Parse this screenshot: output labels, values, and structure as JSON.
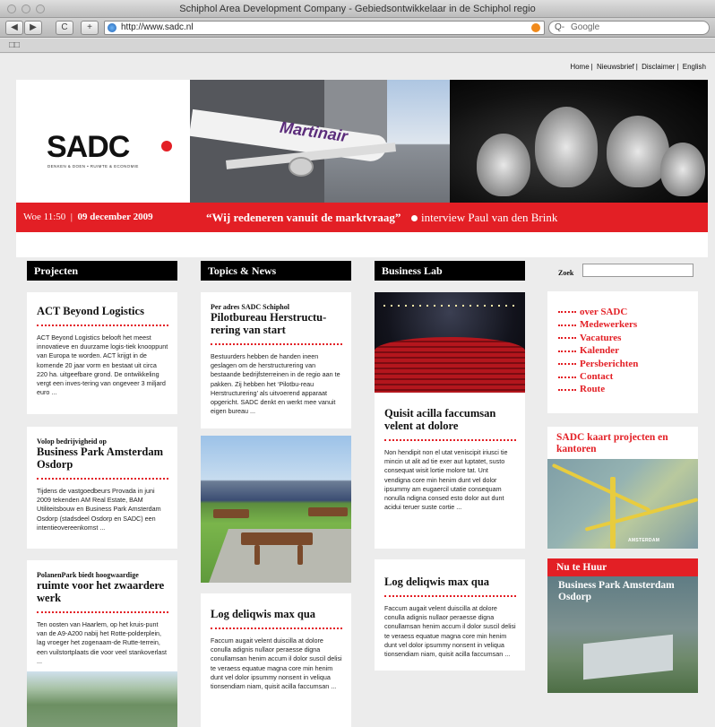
{
  "browser": {
    "window_title": "Schiphol Area Development Company - Gebiedsontwikkelaar in de Schiphol regio",
    "url": "http://www.sadc.nl",
    "search_placeholder": "Google",
    "back_label": "◀",
    "forward_label": "▶",
    "reload_label": "C",
    "add_label": "+",
    "bookmarks_icon": "book-icon"
  },
  "toplinks": [
    "Home",
    "Nieuwsbrief",
    "Disclaimer",
    "English"
  ],
  "banner": {
    "logo": "SADC",
    "logo_tagline": "DENKEN & DOEN • RUIMTE & ECONOMIE",
    "airline_text": "Martinair",
    "date_time": "Woe 11:50",
    "date": "09 december 2009",
    "quote": "“Wij redeneren vanuit de marktvraag”",
    "interview": "interview Paul van den Brink"
  },
  "columns": {
    "projecten": {
      "heading": "Projecten",
      "cards": [
        {
          "kicker": "",
          "title": "ACT Beyond Logistics",
          "body": "ACT Beyond Logistics belooft het meest innovatieve en duurzame logis-tiek knooppunt van Europa te worden. ACT krijgt in de komende 20 jaar vorm en bestaat uit circa 220 ha. uitgeefbare grond. De ontwikkeling vergt een inves-tering van ongeveer 3 miljard euro ..."
        },
        {
          "kicker": "Volop bedrijvigheid op",
          "title": "Business Park Amsterdam Osdorp",
          "body": "Tijdens de vastgoedbeurs Provada in juni 2009 tekenden AM Real Estate, BAM Utiliteitsbouw en Business Park Amsterdam Osdorp (stadsdeel Osdorp en SADC) een intentieovereenkomst ..."
        },
        {
          "kicker": "PolanenPark biedt hoogwaardige",
          "title": "ruimte voor het zwaardere werk",
          "body": "Ten oosten van Haarlem, op het kruis-punt van de A9-A200 nabij het Rotte-polderplein, lag vroeger het zogenaam-de Rutte-terrein, een vuilstortplaats die voor veel stankoverlast ..."
        }
      ]
    },
    "topics": {
      "heading": "Topics & News",
      "cards": [
        {
          "kicker": "Per adres SADC Schiphol",
          "title": "Pilotbureau Herstructu-rering van start",
          "body": "Bestuurders hebben de handen ineen geslagen om de herstructurering van bestaande bedrijfsterreinen in de regio aan te pakken. Zij hebben het ‘Pilotbu-reau Herstructurering’ als uitvoerend apparaat opgericht. SADC denkt en werkt mee vanuit eigen bureau ..."
        },
        {
          "kicker": "",
          "title": "Log deliqwis max qua",
          "body": "Faccum augait velent duiscilla at dolore conulla adignis nullaor peraesse digna conullamsan henim accum il dolor suscil delisi te veraess equatue magna core min henim dunt vel dolor ipsummy nonsent in veliqua tionsendiam niam, quisit acilla faccumsan ..."
        }
      ]
    },
    "lab": {
      "heading": "Business Lab",
      "cards": [
        {
          "kicker": "",
          "title": "Quisit acilla faccumsan velent at dolore",
          "body": "Non hendipit non el utat veniscipit iriusci tie mincin ut alit ad tie exer aut luptatet, susto consequat wisit lortie molore tat. Unt vendigna core min henim dunt vel dolor ipsummy am eugaercil utatie consequam nonulla ndigna consed esto dolor aut dunt acidui teruer suste cortie ..."
        },
        {
          "kicker": "",
          "title": "Log deliqwis max qua",
          "body": "Faccum augait velent duiscilla at dolore conulla adignis nullaor peraesse digna conullamsan henim accum il dolor suscil delisi te veraess equatue magna core min henim dunt vel dolor ipsummy nonsent in veliqua tionsendiam niam, quisit acilla faccumsan ..."
        }
      ]
    }
  },
  "sidebar": {
    "search_label": "Zoek",
    "search_value": "",
    "menu": [
      "over SADC",
      "Medewerkers",
      "Vacatures",
      "Kalender",
      "Persberichten",
      "Contact",
      "Route"
    ],
    "map_title": "SADC kaart projecten en kantoren",
    "map_label": "AMSTERDAM",
    "huur_heading": "Nu te Huur",
    "huur_title": "Business Park Amsterdam Osdorp"
  },
  "colors": {
    "accent": "#e31f25",
    "header": "#000000",
    "background": "#ececec"
  }
}
